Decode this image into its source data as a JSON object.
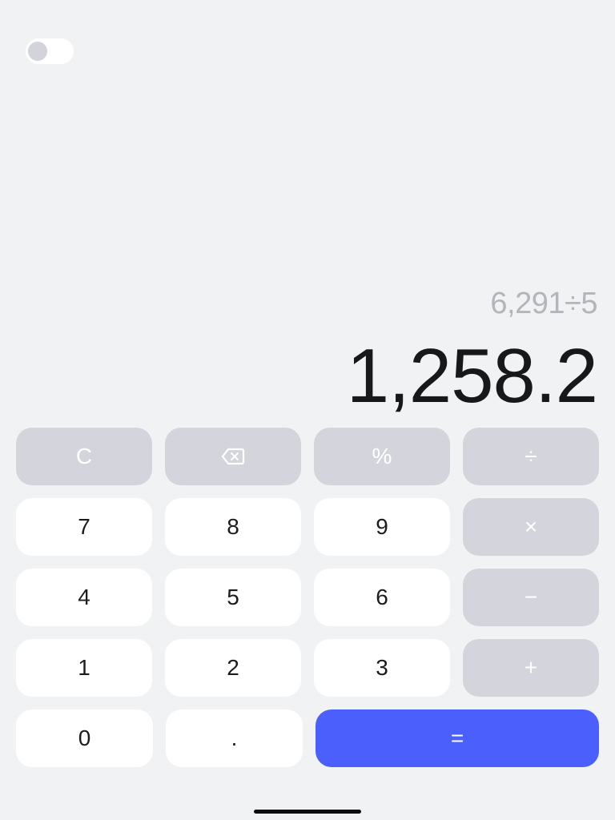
{
  "display": {
    "expression": "6,291÷5",
    "result": "1,258.2"
  },
  "theme_toggle": {
    "state": "off"
  },
  "keys": {
    "clear": "C",
    "backspace_icon": "backspace-icon",
    "percent": "%",
    "divide": "÷",
    "seven": "7",
    "eight": "8",
    "nine": "9",
    "multiply": "×",
    "four": "4",
    "five": "5",
    "six": "6",
    "minus": "−",
    "one": "1",
    "two": "2",
    "three": "3",
    "plus": "+",
    "zero": "0",
    "decimal": ".",
    "equals": "="
  },
  "colors": {
    "background": "#f1f2f4",
    "number_key": "#ffffff",
    "function_key": "#d4d5dc",
    "equals_key": "#4b5ffd",
    "expression_text": "#b3b5bb",
    "result_text": "#17181a"
  }
}
